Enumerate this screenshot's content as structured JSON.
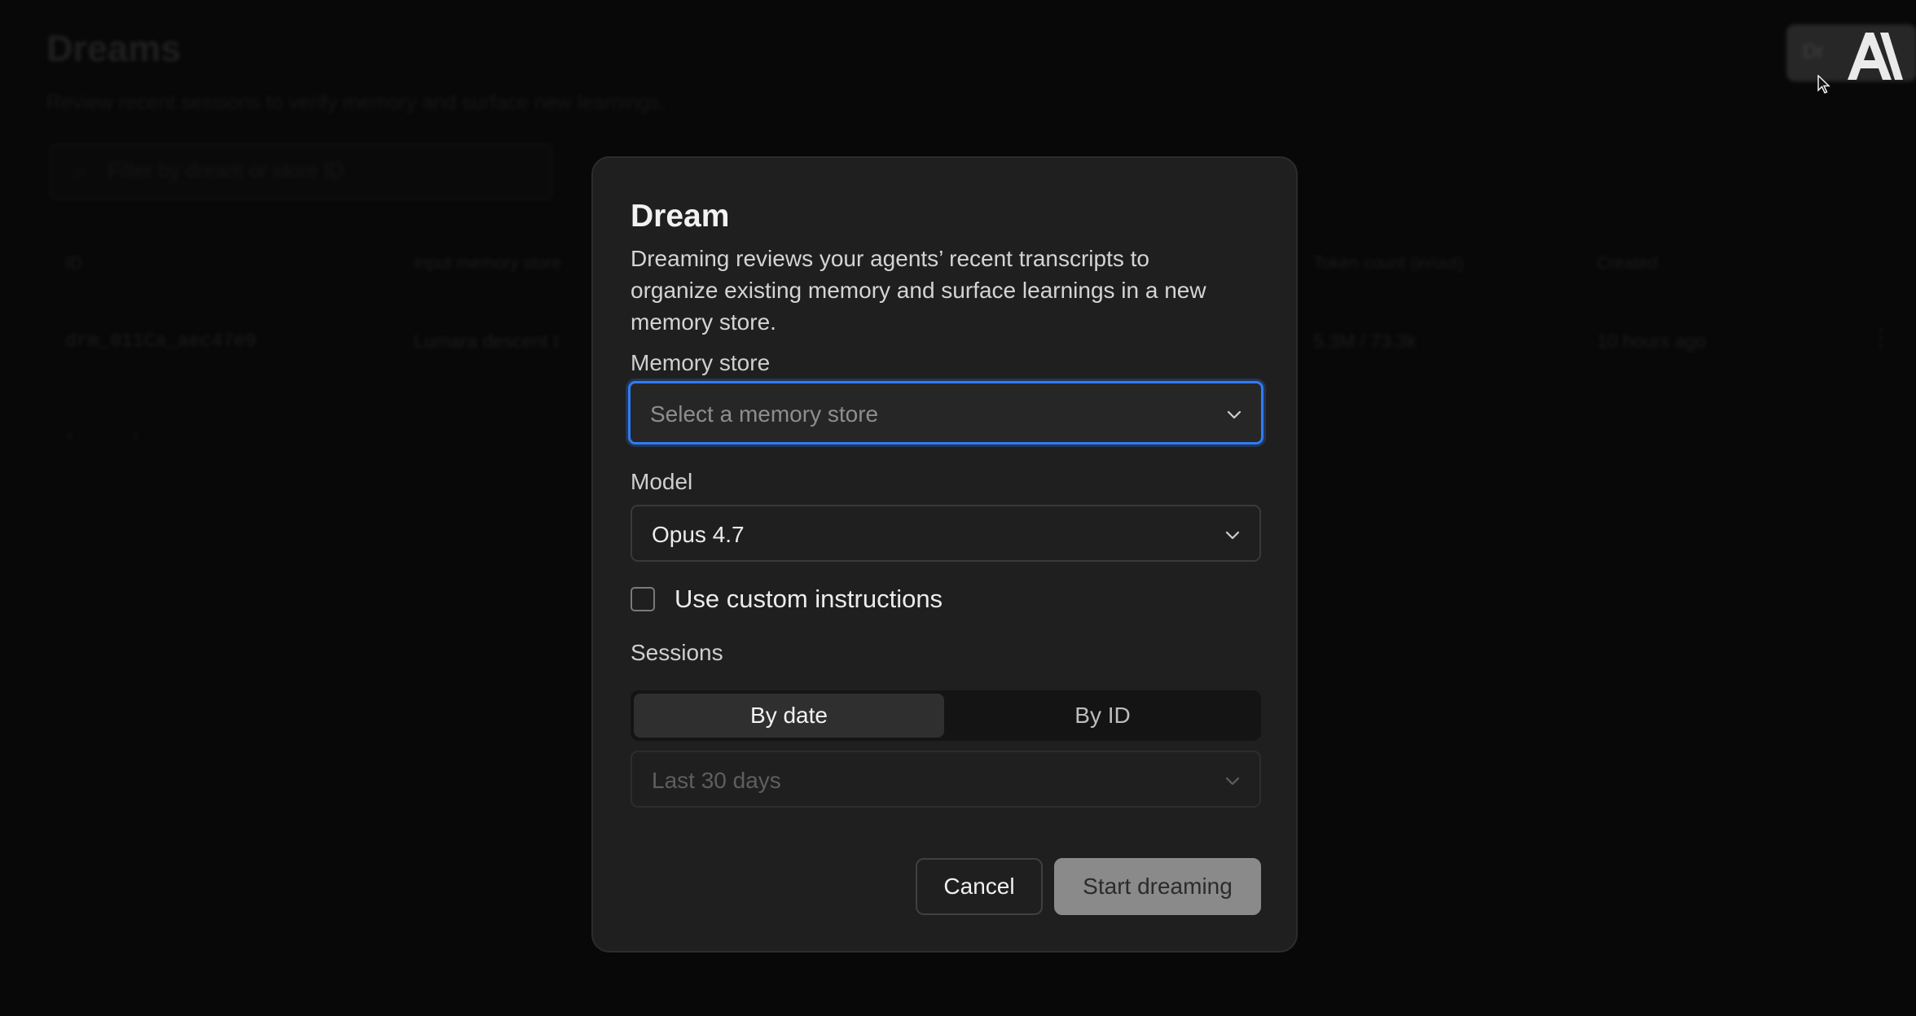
{
  "background": {
    "page_title": "Dreams",
    "page_subtitle": "Review recent sessions to verify memory and surface new learnings.",
    "filter_placeholder": "Filter by dream or store ID",
    "table": {
      "headers": [
        "ID",
        "Input memory store",
        "Token count (in/out)",
        "Created"
      ],
      "row": {
        "id": "drm_011Ca_aec47e9",
        "input_memory_store": "Lumara descent t",
        "token_count": "5.3M / 73.3k",
        "created": "10 hours ago"
      }
    },
    "top_action_label": "Dr"
  },
  "modal": {
    "title": "Dream",
    "description": "Dreaming reviews your agents’ recent transcripts to organize existing memory and surface learnings in a new memory store.",
    "memory_store": {
      "label": "Memory store",
      "placeholder": "Select a memory store"
    },
    "model": {
      "label": "Model",
      "value": "Opus 4.7"
    },
    "custom_instructions": {
      "label": "Use custom instructions",
      "checked": false
    },
    "sessions": {
      "label": "Sessions",
      "tabs": [
        "By date",
        "By ID"
      ],
      "active_tab": "By date",
      "range_value": "Last 30 days"
    },
    "buttons": {
      "cancel": "Cancel",
      "start": "Start dreaming"
    }
  },
  "colors": {
    "focus_ring": "#2f7bf6",
    "modal_bg": "#1f1f1f",
    "page_bg": "#0b0b0b"
  }
}
